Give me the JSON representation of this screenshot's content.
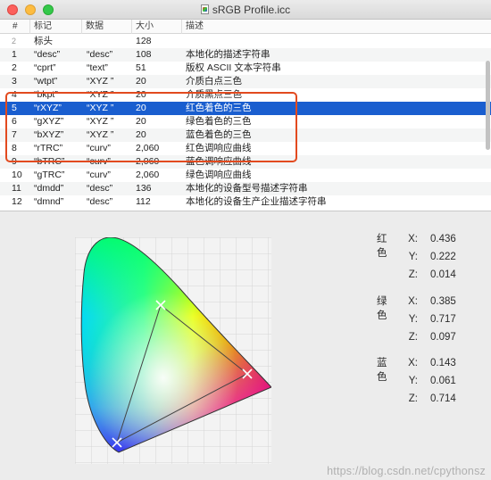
{
  "window": {
    "title": "sRGB Profile.icc"
  },
  "table": {
    "columns": [
      "#",
      "标记",
      "数据",
      "大小",
      "描述"
    ],
    "rows": [
      {
        "num": "2",
        "tag": "标头",
        "data": "",
        "size": "128",
        "desc": ""
      },
      {
        "num": "1",
        "tag": "“desc”",
        "data": "“desc”",
        "size": "108",
        "desc": "本地化的描述字符串"
      },
      {
        "num": "2",
        "tag": "“cprt”",
        "data": "“text”",
        "size": "51",
        "desc": "版权 ASCII 文本字符串"
      },
      {
        "num": "3",
        "tag": "“wtpt”",
        "data": "“XYZ ”",
        "size": "20",
        "desc": "介质白点三色"
      },
      {
        "num": "4",
        "tag": "“bkpt”",
        "data": "“XYZ ”",
        "size": "20",
        "desc": "介质黑点三色"
      },
      {
        "num": "5",
        "tag": "“rXYZ”",
        "data": "“XYZ ”",
        "size": "20",
        "desc": "红色着色的三色"
      },
      {
        "num": "6",
        "tag": "“gXYZ”",
        "data": "“XYZ ”",
        "size": "20",
        "desc": "绿色着色的三色"
      },
      {
        "num": "7",
        "tag": "“bXYZ”",
        "data": "“XYZ ”",
        "size": "20",
        "desc": "蓝色着色的三色"
      },
      {
        "num": "8",
        "tag": "“rTRC”",
        "data": "“curv”",
        "size": "2,060",
        "desc": "红色调响应曲线"
      },
      {
        "num": "9",
        "tag": "“bTRC”",
        "data": "“curv”",
        "size": "2,060",
        "desc": "蓝色调响应曲线"
      },
      {
        "num": "10",
        "tag": "“gTRC”",
        "data": "“curv”",
        "size": "2,060",
        "desc": "绿色调响应曲线"
      },
      {
        "num": "11",
        "tag": "“dmdd”",
        "data": "“desc”",
        "size": "136",
        "desc": "本地化的设备型号描述字符串"
      },
      {
        "num": "12",
        "tag": "“dmnd”",
        "data": "“desc”",
        "size": "112",
        "desc": "本地化的设备生产企业描述字符串"
      }
    ],
    "selected_row": 5
  },
  "values": {
    "red": {
      "label": "红色",
      "x_label": "X:",
      "x": "0.436",
      "y_label": "Y:",
      "y": "0.222",
      "z_label": "Z:",
      "z": "0.014"
    },
    "green": {
      "label": "绿色",
      "x_label": "X:",
      "x": "0.385",
      "y_label": "Y:",
      "y": "0.717",
      "z_label": "Z:",
      "z": "0.097"
    },
    "blue": {
      "label": "蓝色",
      "x_label": "X:",
      "x": "0.143",
      "y_label": "Y:",
      "y": "0.061",
      "z_label": "Z:",
      "z": "0.714"
    }
  },
  "watermark": "https://blog.csdn.net/cpythonsz",
  "colors": {
    "selection": "#1a5ecf",
    "highlight_box": "#e24a1f"
  }
}
